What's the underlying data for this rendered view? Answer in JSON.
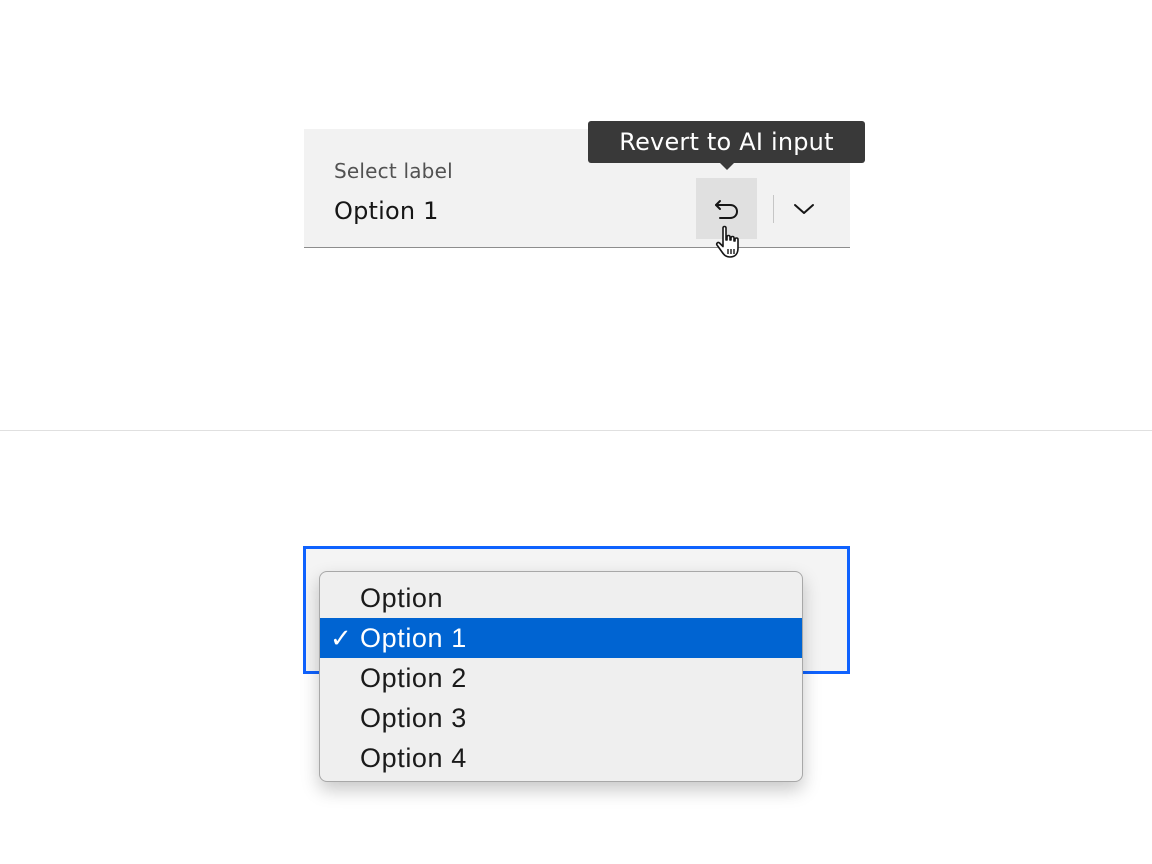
{
  "select": {
    "label": "Select label",
    "value": "Option 1",
    "revert_tooltip": "Revert to AI input"
  },
  "icons": {
    "revert": "revert-icon",
    "chevron": "chevron-down-icon",
    "cursor": "hand-pointer-icon",
    "check": "checkmark-icon"
  },
  "dropdown": {
    "options": [
      "Option",
      "Option 1",
      "Option 2",
      "Option 3",
      "Option 4"
    ],
    "selected": "Option 1",
    "check_glyph": "✓"
  },
  "colors": {
    "focus": "#0f62fe",
    "selected_bg": "#0064d2",
    "tooltip_bg": "#393939",
    "field_bg": "#f2f2f2"
  }
}
